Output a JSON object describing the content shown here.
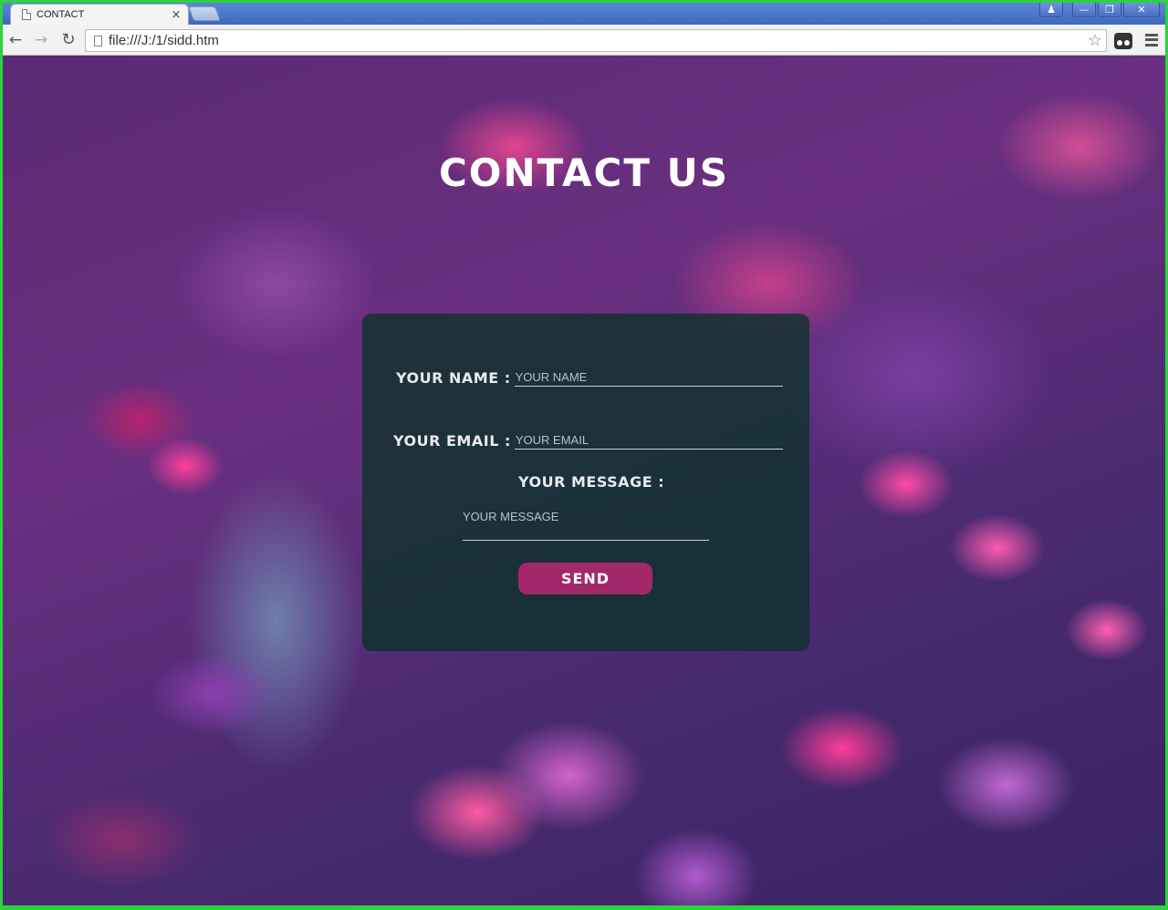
{
  "browser": {
    "tab": {
      "title": "CONTACT",
      "close_glyph": "×"
    },
    "window_controls": {
      "user": "♟",
      "minimize": "—",
      "restore": "❐",
      "close": "✕"
    },
    "nav": {
      "back": "←",
      "forward": "→",
      "reload": "↻"
    },
    "address_bar": {
      "url": "file:///J:/1/sidd.htm",
      "star": "☆"
    }
  },
  "page": {
    "title": "CONTACT US",
    "form": {
      "name_label": "YOUR NAME :",
      "name_placeholder": "YOUR NAME",
      "email_label": "YOUR EMAIL :",
      "email_placeholder": "YOUR EMAIL",
      "message_label": "YOUR MESSAGE :",
      "message_placeholder": "YOUR MESSAGE",
      "send_label": "SEND"
    }
  },
  "colors": {
    "panel": "#0a3228",
    "send_button": "#a32869",
    "title_text": "#ffffff"
  }
}
